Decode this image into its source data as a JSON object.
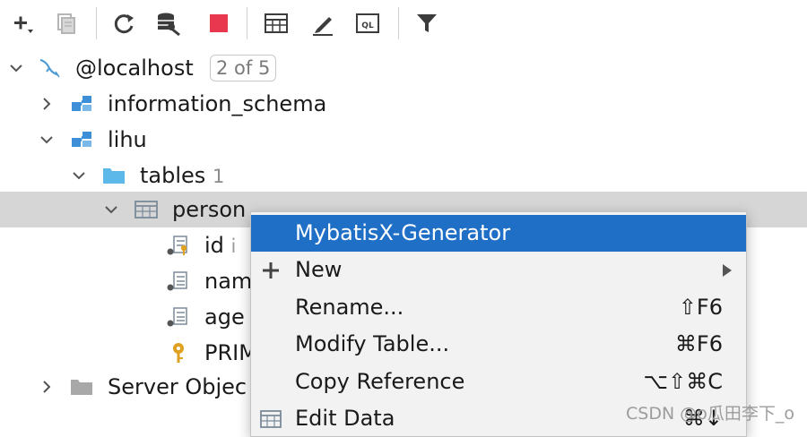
{
  "tree": {
    "host": {
      "label": "@localhost",
      "badge": "2 of 5"
    },
    "schema_info": {
      "label": "information_schema"
    },
    "schema_lihu": {
      "label": "lihu"
    },
    "tables": {
      "label": "tables",
      "count": "1"
    },
    "table_person": {
      "label": "person"
    },
    "col_id": {
      "label": "id",
      "hint": "i"
    },
    "col_name": {
      "label": "nam"
    },
    "col_age": {
      "label": "age"
    },
    "key_primary": {
      "label": "PRIM"
    },
    "server_objects": {
      "label": "Server Objec"
    }
  },
  "context_menu": {
    "items": [
      {
        "label": "MybatisX-Generator",
        "shortcut": ""
      },
      {
        "label": "New",
        "shortcut": ""
      },
      {
        "label": "Rename...",
        "shortcut": "⇧F6"
      },
      {
        "label": "Modify Table...",
        "shortcut": "⌘F6"
      },
      {
        "label": "Copy Reference",
        "shortcut": "⌥⇧⌘C"
      },
      {
        "label": "Edit Data",
        "shortcut": "⌘↓"
      }
    ]
  },
  "watermark": "CSDN @o瓜田李下_o",
  "colors": {
    "accent": "#1f6fc6",
    "selection": "#d6d6d6",
    "folder": "#5bb8e8",
    "schema_icon": "#3d8fd8",
    "key": "#e0a020",
    "stop": "#e8384f"
  }
}
